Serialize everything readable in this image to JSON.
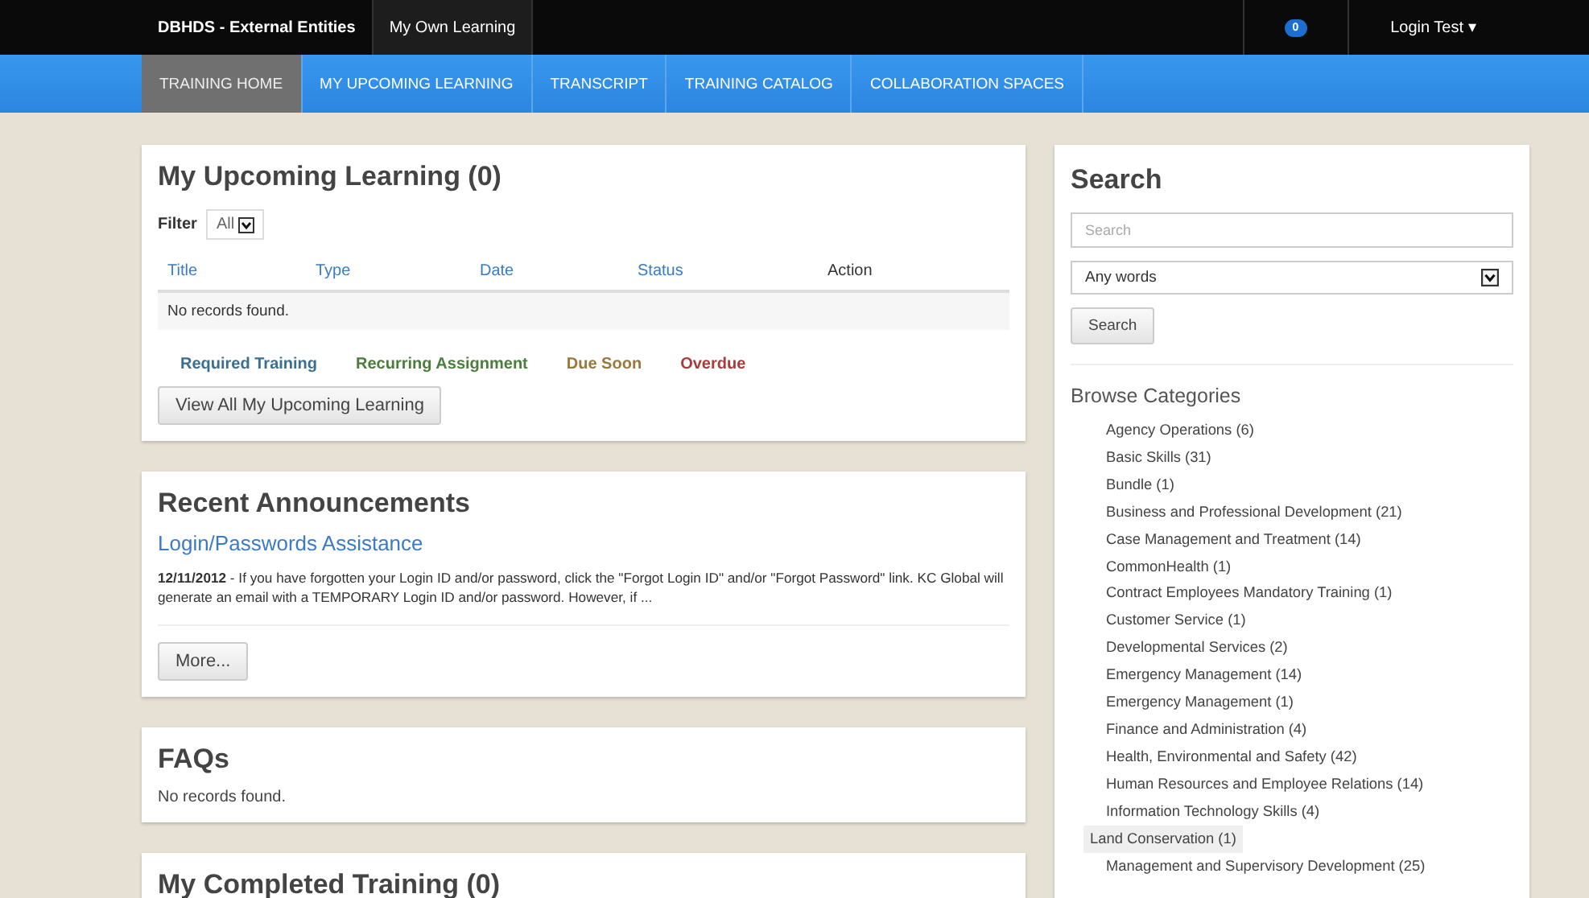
{
  "top_bar": {
    "items": [
      {
        "label": "DBHDS - External Entities",
        "selected": false
      },
      {
        "label": "My Own Learning",
        "selected": true
      }
    ],
    "notification_count": "0",
    "user": "Login Test",
    "user_caret": "▾"
  },
  "nav": {
    "tabs": [
      {
        "label": "TRAINING HOME",
        "selected": true
      },
      {
        "label": "MY UPCOMING LEARNING",
        "selected": false
      },
      {
        "label": "TRANSCRIPT",
        "selected": false
      },
      {
        "label": "TRAINING CATALOG",
        "selected": false
      },
      {
        "label": "COLLABORATION SPACES",
        "selected": false
      }
    ]
  },
  "upcoming": {
    "title": "My Upcoming Learning (0)",
    "filter_label": "Filter",
    "filter_value": "All",
    "columns": [
      "Title",
      "Type",
      "Date",
      "Status",
      "Action"
    ],
    "empty": "No records found.",
    "legend": [
      {
        "label": "Required Training",
        "color": "#3b6f8f"
      },
      {
        "label": "Recurring Assignment",
        "color": "#4b7d3c"
      },
      {
        "label": "Due Soon",
        "color": "#98793c"
      },
      {
        "label": "Overdue",
        "color": "#a83b3b"
      }
    ],
    "button": "View All My Upcoming Learning"
  },
  "announcements": {
    "title": "Recent Announcements",
    "link": "Login/Passwords Assistance",
    "text": "**12/11/2012** - If you have forgotten your Login ID and/or password, click the \"Forgot Login ID\" and/or \"Forgot Password\" link. KC Global will generate an email with a TEMPORARY Login ID and/or password. However, if ...",
    "button": "More..."
  },
  "faqs": {
    "title": "FAQs",
    "empty": "No records found."
  },
  "completed": {
    "title": "My Completed Training (0)"
  },
  "search": {
    "title": "Search",
    "placeholder": "Search",
    "mode": "Any words",
    "button": "Search",
    "browse_title": "Browse Categories",
    "categories": [
      {
        "label": "Agency Operations (6)",
        "selected": false
      },
      {
        "label": "Basic Skills (31)",
        "selected": false
      },
      {
        "label": "Bundle (1)",
        "selected": false
      },
      {
        "label": "Business and Professional Development (21)",
        "selected": false
      },
      {
        "label": "Case Management and Treatment (14)",
        "selected": false
      },
      {
        "label": "CommonHealth (1)",
        "selected": false
      },
      {
        "label": "Contract Employees Mandatory Training (1)",
        "selected": false
      },
      {
        "label": "Customer Service (1)",
        "selected": false
      },
      {
        "label": "Developmental Services (2)",
        "selected": false
      },
      {
        "label": "Emergency Management (14)",
        "selected": false
      },
      {
        "label": "Emergency Management (1)",
        "selected": false
      },
      {
        "label": "Finance and Administration (4)",
        "selected": false
      },
      {
        "label": "Health, Environmental and Safety (42)",
        "selected": false
      },
      {
        "label": "Human Resources and Employee Relations (14)",
        "selected": false
      },
      {
        "label": "Information Technology Skills (4)",
        "selected": false
      },
      {
        "label": "Land Conservation (1)",
        "selected": true
      },
      {
        "label": "Management and Supervisory Development (25)",
        "selected": false
      }
    ]
  }
}
